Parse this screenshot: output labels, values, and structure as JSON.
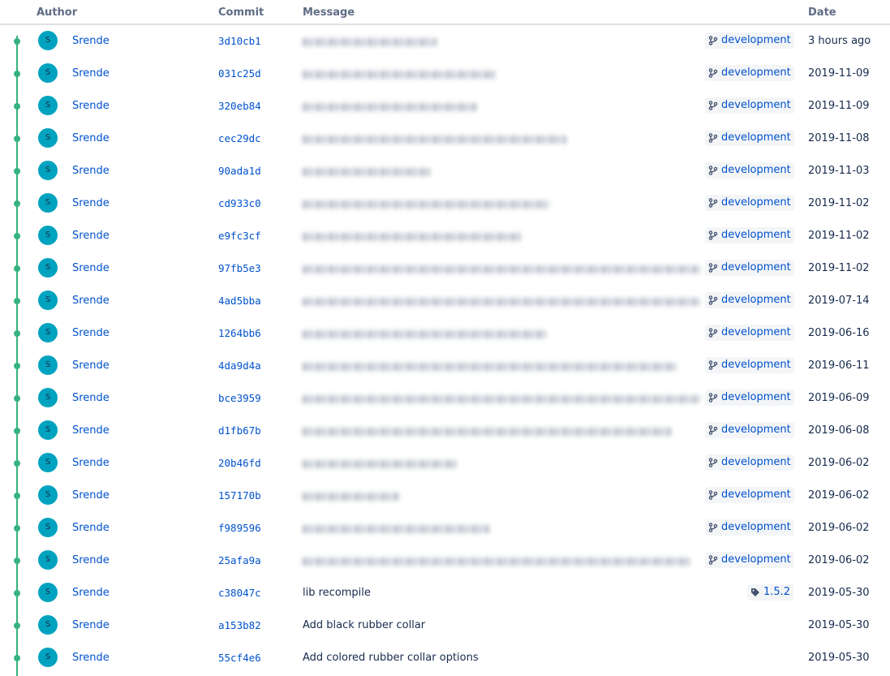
{
  "columns": {
    "author": "Author",
    "commit": "Commit",
    "message": "Message",
    "date": "Date"
  },
  "colors": {
    "graph": "#36b37e",
    "avatar": "#00a3bf",
    "link": "#0052cc"
  },
  "commits": [
    {
      "avatar": "S",
      "author": "Srende",
      "hash": "3d10cb1",
      "message": "",
      "message_blurred": true,
      "ref": {
        "type": "branch",
        "label": "development",
        "icon": "branch-icon"
      },
      "date": "3 hours ago"
    },
    {
      "avatar": "S",
      "author": "Srende",
      "hash": "031c25d",
      "message": "",
      "message_blurred": true,
      "ref": {
        "type": "branch",
        "label": "development",
        "icon": "branch-icon"
      },
      "date": "2019-11-09"
    },
    {
      "avatar": "S",
      "author": "Srende",
      "hash": "320eb84",
      "message": "",
      "message_blurred": true,
      "ref": {
        "type": "branch",
        "label": "development",
        "icon": "branch-icon"
      },
      "date": "2019-11-09"
    },
    {
      "avatar": "S",
      "author": "Srende",
      "hash": "cec29dc",
      "message": "",
      "message_blurred": true,
      "ref": {
        "type": "branch",
        "label": "development",
        "icon": "branch-icon"
      },
      "date": "2019-11-08"
    },
    {
      "avatar": "S",
      "author": "Srende",
      "hash": "90ada1d",
      "message": "",
      "message_blurred": true,
      "ref": {
        "type": "branch",
        "label": "development",
        "icon": "branch-icon"
      },
      "date": "2019-11-03"
    },
    {
      "avatar": "S",
      "author": "Srende",
      "hash": "cd933c0",
      "message": "",
      "message_blurred": true,
      "ref": {
        "type": "branch",
        "label": "development",
        "icon": "branch-icon"
      },
      "date": "2019-11-02"
    },
    {
      "avatar": "S",
      "author": "Srende",
      "hash": "e9fc3cf",
      "message": "",
      "message_blurred": true,
      "ref": {
        "type": "branch",
        "label": "development",
        "icon": "branch-icon"
      },
      "date": "2019-11-02"
    },
    {
      "avatar": "S",
      "author": "Srende",
      "hash": "97fb5e3",
      "message": "",
      "message_blurred": true,
      "ref": {
        "type": "branch",
        "label": "development",
        "icon": "branch-icon"
      },
      "date": "2019-11-02"
    },
    {
      "avatar": "S",
      "author": "Srende",
      "hash": "4ad5bba",
      "message": "",
      "message_blurred": true,
      "ref": {
        "type": "branch",
        "label": "development",
        "icon": "branch-icon"
      },
      "date": "2019-07-14"
    },
    {
      "avatar": "S",
      "author": "Srende",
      "hash": "1264bb6",
      "message": "",
      "message_blurred": true,
      "ref": {
        "type": "branch",
        "label": "development",
        "icon": "branch-icon"
      },
      "date": "2019-06-16"
    },
    {
      "avatar": "S",
      "author": "Srende",
      "hash": "4da9d4a",
      "message": "",
      "message_blurred": true,
      "ref": {
        "type": "branch",
        "label": "development",
        "icon": "branch-icon"
      },
      "date": "2019-06-11"
    },
    {
      "avatar": "S",
      "author": "Srende",
      "hash": "bce3959",
      "message": "",
      "message_blurred": true,
      "ref": {
        "type": "branch",
        "label": "development",
        "icon": "branch-icon"
      },
      "date": "2019-06-09"
    },
    {
      "avatar": "S",
      "author": "Srende",
      "hash": "d1fb67b",
      "message": "",
      "message_blurred": true,
      "ref": {
        "type": "branch",
        "label": "development",
        "icon": "branch-icon"
      },
      "date": "2019-06-08"
    },
    {
      "avatar": "S",
      "author": "Srende",
      "hash": "20b46fd",
      "message": "",
      "message_blurred": true,
      "ref": {
        "type": "branch",
        "label": "development",
        "icon": "branch-icon"
      },
      "date": "2019-06-02"
    },
    {
      "avatar": "S",
      "author": "Srende",
      "hash": "157170b",
      "message": "",
      "message_blurred": true,
      "ref": {
        "type": "branch",
        "label": "development",
        "icon": "branch-icon"
      },
      "date": "2019-06-02"
    },
    {
      "avatar": "S",
      "author": "Srende",
      "hash": "f989596",
      "message": "",
      "message_blurred": true,
      "ref": {
        "type": "branch",
        "label": "development",
        "icon": "branch-icon"
      },
      "date": "2019-06-02"
    },
    {
      "avatar": "S",
      "author": "Srende",
      "hash": "25afa9a",
      "message": "",
      "message_blurred": true,
      "ref": {
        "type": "branch",
        "label": "development",
        "icon": "branch-icon"
      },
      "date": "2019-06-02"
    },
    {
      "avatar": "S",
      "author": "Srende",
      "hash": "c38047c",
      "message": "lib recompile",
      "message_blurred": false,
      "ref": {
        "type": "tag",
        "label": "1.5.2",
        "icon": "tag-icon"
      },
      "date": "2019-05-30"
    },
    {
      "avatar": "S",
      "author": "Srende",
      "hash": "a153b82",
      "message": "Add black rubber collar",
      "message_blurred": false,
      "ref": null,
      "date": "2019-05-30"
    },
    {
      "avatar": "S",
      "author": "Srende",
      "hash": "55cf4e6",
      "message": "Add colored rubber collar options",
      "message_blurred": false,
      "ref": null,
      "date": "2019-05-30"
    }
  ]
}
